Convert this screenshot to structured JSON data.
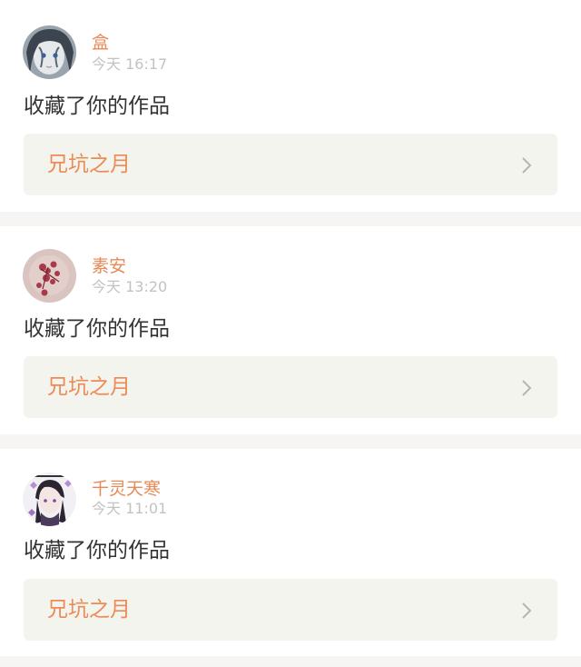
{
  "notifications": [
    {
      "username": "盒",
      "time": "今天 16:17",
      "action": "收藏了你的作品",
      "work_title": "兄坑之月",
      "avatar_icon": "avatar-dark-hair-portrait"
    },
    {
      "username": "素安",
      "time": "今天 13:20",
      "action": "收藏了你的作品",
      "work_title": "兄坑之月",
      "avatar_icon": "avatar-red-flower"
    },
    {
      "username": "千灵天寒",
      "time": "今天 11:01",
      "action": "收藏了你的作品",
      "work_title": "兄坑之月",
      "avatar_icon": "avatar-anime-girl-purple"
    }
  ],
  "colors": {
    "username": "#e68a56",
    "work_title": "#ec8b55",
    "timestamp": "#c2c2c2",
    "action_text": "#333333",
    "work_card_bg": "#f4f4ef",
    "separator": "#f7f4f4"
  }
}
